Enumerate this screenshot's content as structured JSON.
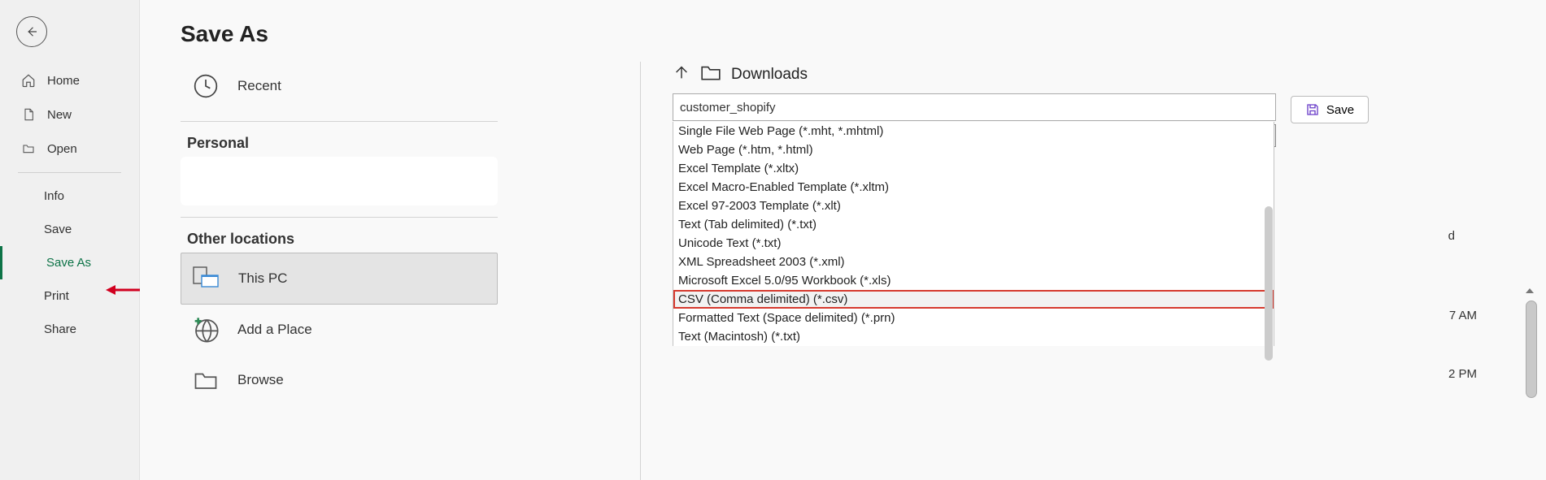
{
  "sidebar": {
    "items": [
      {
        "label": "Home"
      },
      {
        "label": "New"
      },
      {
        "label": "Open"
      },
      {
        "label": "Info"
      },
      {
        "label": "Save"
      },
      {
        "label": "Save As"
      },
      {
        "label": "Print"
      },
      {
        "label": "Share"
      }
    ]
  },
  "page": {
    "title": "Save As"
  },
  "locations": {
    "recent": "Recent",
    "personal_header": "Personal",
    "other_header": "Other locations",
    "this_pc": "This PC",
    "add_place": "Add a Place",
    "browse": "Browse"
  },
  "save_panel": {
    "folder": "Downloads",
    "filename": "customer_shopify",
    "filetype_selected": "CSV (Comma delimited) (*.csv)",
    "save_label": "Save",
    "options": [
      "Single File Web Page (*.mht, *.mhtml)",
      "Web Page (*.htm, *.html)",
      "Excel Template (*.xltx)",
      "Excel Macro-Enabled Template (*.xltm)",
      "Excel 97-2003 Template (*.xlt)",
      "Text (Tab delimited) (*.txt)",
      "Unicode Text (*.txt)",
      "XML Spreadsheet 2003 (*.xml)",
      "Microsoft Excel 5.0/95 Workbook (*.xls)",
      "CSV (Comma delimited) (*.csv)",
      "Formatted Text (Space delimited) (*.prn)",
      "Text (Macintosh) (*.txt)"
    ]
  },
  "far_right": {
    "time1": "7 AM",
    "time2": "2 PM",
    "letter": "d"
  }
}
